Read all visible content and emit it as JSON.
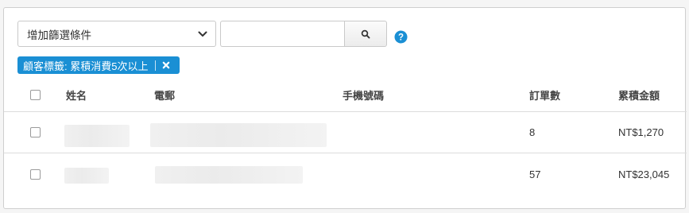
{
  "filter": {
    "select_label": "增加篩選條件",
    "search_value": "",
    "search_placeholder": ""
  },
  "active_tag": {
    "label": "顧客標籤: 累積消費5次以上"
  },
  "table": {
    "headers": {
      "name": "姓名",
      "phone": "電郵",
      "mobile": "手機號碼",
      "orders": "訂單數",
      "total": "累積金額"
    },
    "rows": [
      {
        "name": "",
        "email": "",
        "mobile": "",
        "orders": "8",
        "total": "NT$1,270"
      },
      {
        "name": "",
        "email": "",
        "mobile": "",
        "orders": "57",
        "total": "NT$23,045"
      }
    ]
  },
  "colors": {
    "accent": "#1a8fd4",
    "border": "#c9c9c9"
  },
  "icons": {
    "select": "chevron-down-icon",
    "search": "search-icon",
    "help": "help-icon",
    "tag_remove": "close-icon"
  }
}
